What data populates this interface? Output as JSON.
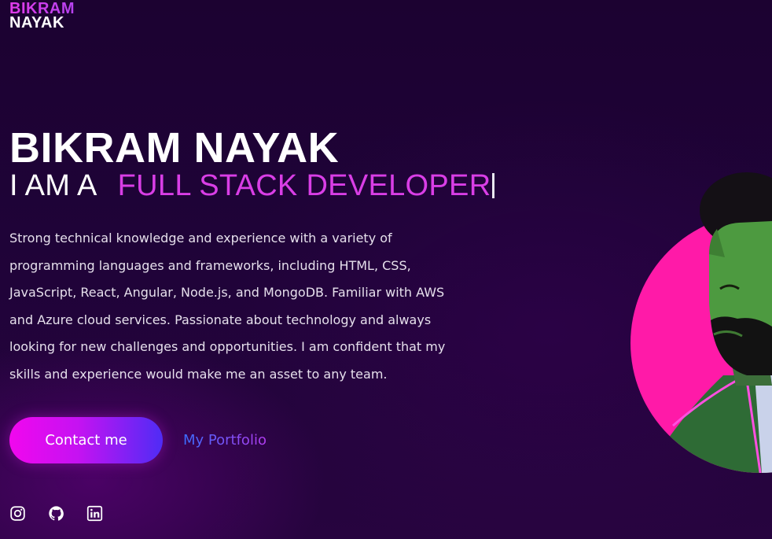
{
  "logo": {
    "line1": "BIKRAM",
    "line2": "NAYAK"
  },
  "hero": {
    "name": "BIKRAM NAYAK",
    "role_prefix": "I AM A",
    "role": "FULL STACK DEVELOPER",
    "description": "Strong technical knowledge and experience with a variety of programming languages and frameworks, including HTML, CSS, JavaScript, React, Angular, Node.js, and MongoDB. Familiar with AWS and Azure cloud services. Passionate about technology and always looking for new challenges and opportunities. I am confident that my skills and experience would make me an asset to any team."
  },
  "actions": {
    "contact_label": "Contact me",
    "portfolio_label": "My Portfolio"
  },
  "social": [
    {
      "icon": "instagram-icon"
    },
    {
      "icon": "github-icon"
    },
    {
      "icon": "linkedin-icon"
    }
  ],
  "colors": {
    "background": "#1f0338",
    "accent": "#d93ee6",
    "button_gradient_start": "#f107ee",
    "button_gradient_end": "#4f2cf5",
    "portrait_circle": "#ff1aa8"
  }
}
